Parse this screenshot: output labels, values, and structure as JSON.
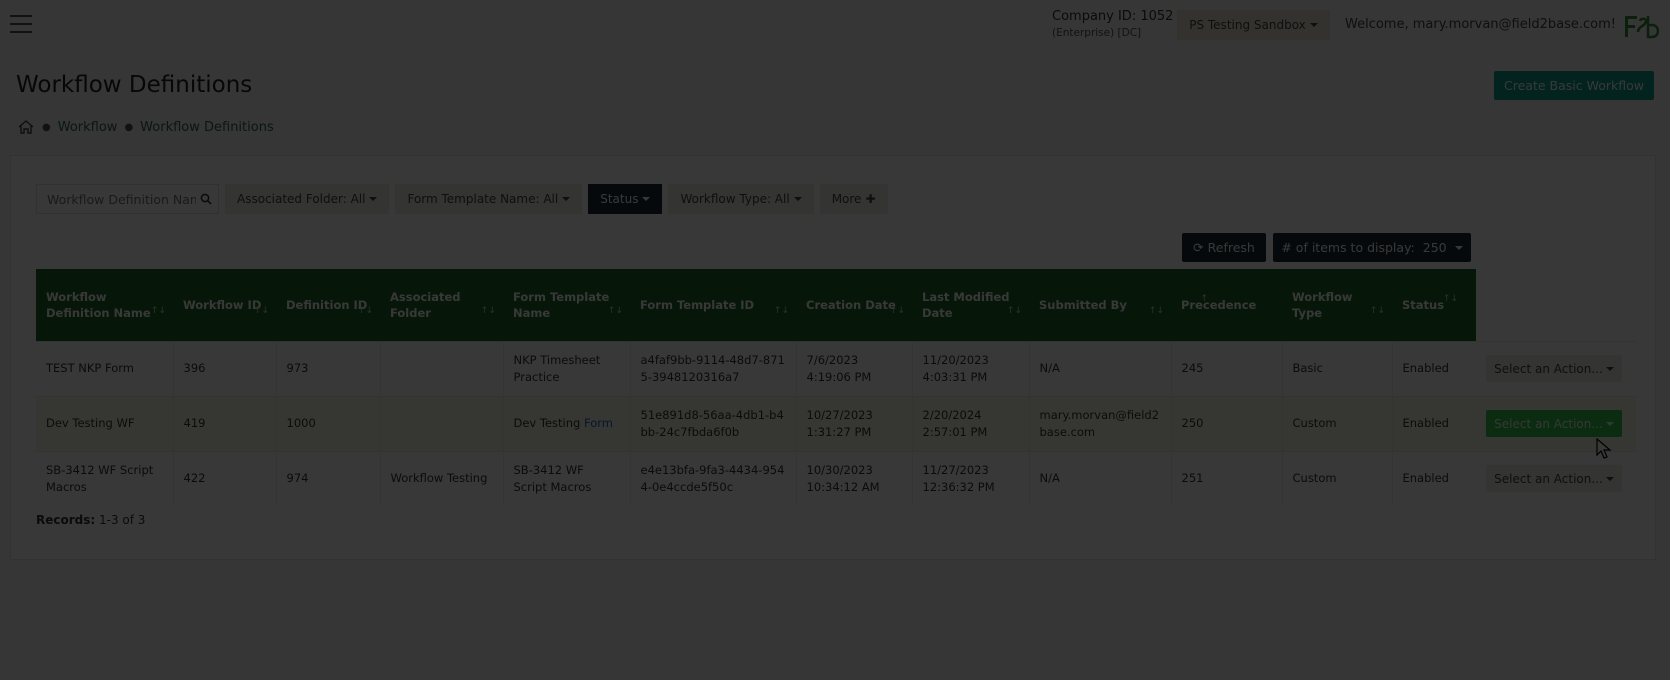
{
  "header": {
    "company_id": "Company ID: 1052",
    "company_sub": "(Enterprise) [DC]",
    "sandbox_label": "PS Testing Sandbox",
    "welcome": "Welcome, mary.morvan@field2base.com!"
  },
  "page": {
    "title": "Workflow Definitions",
    "create_button": "Create Basic Workflow"
  },
  "breadcrumb": {
    "items": [
      "Workflow",
      "Workflow Definitions"
    ]
  },
  "filters": {
    "search_placeholder": "Workflow Definition Name",
    "associated_folder": "Associated Folder: All",
    "form_template_name": "Form Template Name: All",
    "status": "Status",
    "workflow_type": "Workflow Type: All",
    "more": "More"
  },
  "toolbar": {
    "refresh": "Refresh",
    "items_label": "# of items to display:",
    "items_value": "250"
  },
  "table": {
    "headers": [
      "Workflow Definition Name",
      "Workflow ID",
      "Definition ID",
      "Associated Folder",
      "Form Template Name",
      "Form Template ID",
      "Creation Date",
      "Last Modified Date",
      "Submitted By",
      "Precedence",
      "Workflow Type",
      "Status"
    ],
    "rows": [
      {
        "name": "TEST NKP Form",
        "workflow_id": "396",
        "definition_id": "973",
        "folder": "",
        "template_name": "NKP Timesheet Practice",
        "template_id": "a4faf9bb-9114-48d7-8715-3948120316a7",
        "created": "7/6/2023 4:19:06 PM",
        "modified": "11/20/2023 4:03:31 PM",
        "submitted_by": "N/A",
        "precedence": "245",
        "type": "Basic",
        "status": "Enabled",
        "action": "Select an Action..."
      },
      {
        "name": "Dev Testing WF",
        "workflow_id": "419",
        "definition_id": "1000",
        "folder": "",
        "template_name_prefix": "Dev Testing ",
        "template_name_link": "Form",
        "template_id": "51e891d8-56aa-4db1-b4bb-24c7fbda6f0b",
        "created": "10/27/2023 1:31:27 PM",
        "modified": "2/20/2024 2:57:01 PM",
        "submitted_by": "mary.morvan@field2base.com",
        "precedence": "250",
        "type": "Custom",
        "status": "Enabled",
        "action": "Select an Action..."
      },
      {
        "name": "SB-3412 WF Script Macros",
        "workflow_id": "422",
        "definition_id": "974",
        "folder": "Workflow Testing",
        "template_name": "SB-3412 WF Script Macros",
        "template_id": "e4e13bfa-9fa3-4434-9544-0e4ccde5f50c",
        "created": "10/30/2023 10:34:12 AM",
        "modified": "11/27/2023 12:36:32 PM",
        "submitted_by": "N/A",
        "precedence": "251",
        "type": "Custom",
        "status": "Enabled",
        "action": "Select an Action..."
      }
    ]
  },
  "records": {
    "label": "Records:",
    "value": "1-3 of 3"
  },
  "colors": {
    "header_green": "#1d6a2c",
    "create_teal": "#0b9e88",
    "dark_button": "#1d2a33",
    "highlight_green": "#37c653"
  }
}
